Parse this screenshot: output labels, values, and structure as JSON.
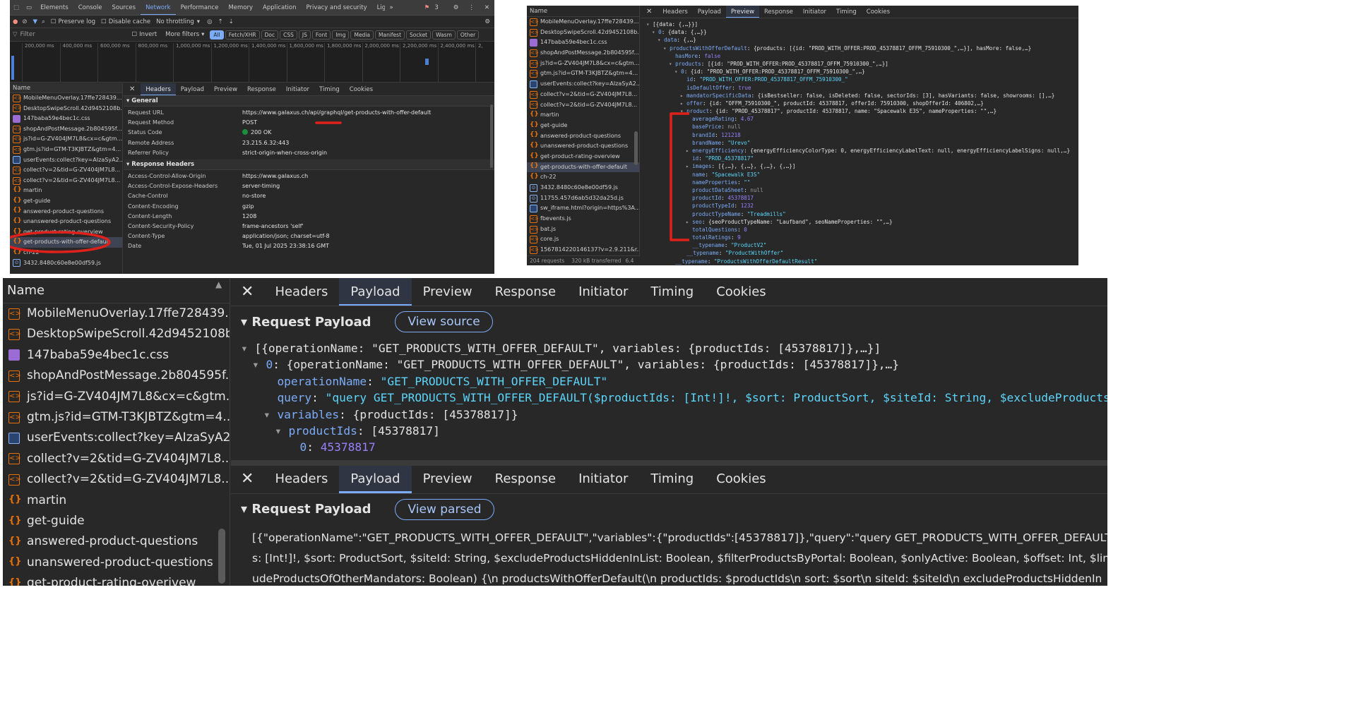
{
  "p1": {
    "toolbar_tabs": [
      "Elements",
      "Console",
      "Sources",
      "Network",
      "Performance",
      "Memory",
      "Application",
      "Privacy and security",
      "Lighthouse"
    ],
    "active_tab": "Network",
    "badge": "3",
    "preserve_log": "Preserve log",
    "disable_cache": "Disable cache",
    "throttling": "No throttling",
    "filter_placeholder": "Filter",
    "invert": "Invert",
    "more_filters": "More filters",
    "chips": [
      "All",
      "Fetch/XHR",
      "Doc",
      "CSS",
      "JS",
      "Font",
      "Img",
      "Media",
      "Manifest",
      "Socket",
      "Wasm",
      "Other"
    ],
    "ticks": [
      "200,000 ms",
      "400,000 ms",
      "600,000 ms",
      "800,000 ms",
      "1,000,000 ms",
      "1,200,000 ms",
      "1,400,000 ms",
      "1,600,000 ms",
      "1,800,000 ms",
      "2,000,000 ms",
      "2,200,000 ms",
      "2,400,000 ms",
      "2,"
    ],
    "list_header": "Name",
    "requests": [
      {
        "name": "MobileMenuOverlay.17ffe728439...",
        "type": "js"
      },
      {
        "name": "DesktopSwipeScroll.42d9452108b...",
        "type": "js"
      },
      {
        "name": "147baba59e4bec1c.css",
        "type": "css"
      },
      {
        "name": "shopAndPostMessage.2b804595f...",
        "type": "js"
      },
      {
        "name": "js?id=G-ZV404JM7L8&cx=c&gtm...",
        "type": "js"
      },
      {
        "name": "gtm.js?id=GTM-T3KJBTZ&gtm=4...",
        "type": "js"
      },
      {
        "name": "userEvents:collect?key=AIzaSyA2...",
        "type": "img"
      },
      {
        "name": "collect?v=2&tid=G-ZV404JM7L8...",
        "type": "js"
      },
      {
        "name": "collect?v=2&tid=G-ZV404JM7L8...",
        "type": "js"
      },
      {
        "name": "martin",
        "type": "gql"
      },
      {
        "name": "get-guide",
        "type": "gql"
      },
      {
        "name": "answered-product-questions",
        "type": "gql"
      },
      {
        "name": "unanswered-product-questions",
        "type": "gql"
      },
      {
        "name": "get-product-rating-overview",
        "type": "gql"
      },
      {
        "name": "get-products-with-offer-default",
        "type": "gql"
      },
      {
        "name": "ch-22",
        "type": "gql"
      },
      {
        "name": "3432.8480c60e8e00df59.js",
        "type": "doc"
      }
    ],
    "detail_tabs": [
      "Headers",
      "Payload",
      "Preview",
      "Response",
      "Initiator",
      "Timing",
      "Cookies"
    ],
    "detail_active": "Headers",
    "general_title": "General",
    "general": [
      {
        "k": "Request URL",
        "v": "https://www.galaxus.ch/api/graphql/get-products-with-offer-default"
      },
      {
        "k": "Request Method",
        "v": "POST"
      },
      {
        "k": "Status Code",
        "v": "200 OK"
      },
      {
        "k": "Remote Address",
        "v": "23.215.6.32:443"
      },
      {
        "k": "Referrer Policy",
        "v": "strict-origin-when-cross-origin"
      }
    ],
    "response_title": "Response Headers",
    "response": [
      {
        "k": "Access-Control-Allow-Origin",
        "v": "https://www.galaxus.ch"
      },
      {
        "k": "Access-Control-Expose-Headers",
        "v": "server-timing"
      },
      {
        "k": "Cache-Control",
        "v": "no-store"
      },
      {
        "k": "Content-Encoding",
        "v": "gzip"
      },
      {
        "k": "Content-Length",
        "v": "1208"
      },
      {
        "k": "Content-Security-Policy",
        "v": "frame-ancestors 'self'"
      },
      {
        "k": "Content-Type",
        "v": "application/json; charset=utf-8"
      },
      {
        "k": "Date",
        "v": "Tue, 01 Jul 2025 23:38:16 GMT"
      }
    ],
    "colors": {
      "status_ok": "#1e8e3e",
      "annotation": "#e0201b"
    }
  },
  "p2": {
    "list_header": "Name",
    "requests": [
      {
        "name": "MobileMenuOverlay.17ffe728439...",
        "type": "js"
      },
      {
        "name": "DesktopSwipeScroll.42d9452108b...",
        "type": "js"
      },
      {
        "name": "147baba59e4bec1c.css",
        "type": "css"
      },
      {
        "name": "shopAndPostMessage.2b804595f...",
        "type": "js"
      },
      {
        "name": "js?id=G-ZV404JM7L8&cx=c&gtm...",
        "type": "js"
      },
      {
        "name": "gtm.js?id=GTM-T3KJBTZ&gtm=4...",
        "type": "js"
      },
      {
        "name": "userEvents:collect?key=AIzaSyA2...",
        "type": "img"
      },
      {
        "name": "collect?v=2&tid=G-ZV404JM7L8...",
        "type": "js"
      },
      {
        "name": "collect?v=2&tid=G-ZV404JM7L8...",
        "type": "js"
      },
      {
        "name": "martin",
        "type": "gql"
      },
      {
        "name": "get-guide",
        "type": "gql"
      },
      {
        "name": "answered-product-questions",
        "type": "gql"
      },
      {
        "name": "unanswered-product-questions",
        "type": "gql"
      },
      {
        "name": "get-product-rating-overview",
        "type": "gql"
      },
      {
        "name": "get-products-with-offer-default",
        "type": "gql"
      },
      {
        "name": "ch-22",
        "type": "gql"
      },
      {
        "name": "3432.8480c60e8e00df59.js",
        "type": "doc"
      },
      {
        "name": "11755.457d6ab5d32da25d.js",
        "type": "doc"
      },
      {
        "name": "sw_iframe.html?origin=https%3A...",
        "type": "img"
      },
      {
        "name": "fbevents.js",
        "type": "js"
      },
      {
        "name": "bat.js",
        "type": "js"
      },
      {
        "name": "core.js",
        "type": "js"
      },
      {
        "name": "1567814220146137?v=2.9.211&r...",
        "type": "js"
      }
    ],
    "status": "204 requests",
    "transferred": "320 kB transferred",
    "transferred_tail": "6.4",
    "detail_tabs": [
      "Headers",
      "Payload",
      "Preview",
      "Response",
      "Initiator",
      "Timing",
      "Cookies"
    ],
    "detail_active": "Preview",
    "tree": [
      {
        "i": 0,
        "a": "▾",
        "t": [
          [
            "k2",
            "[{data: {,…}}]"
          ]
        ]
      },
      {
        "i": 1,
        "a": "▾",
        "t": [
          [
            "k1",
            "0"
          ],
          [
            "k2",
            ": {data: {,…}}"
          ]
        ]
      },
      {
        "i": 2,
        "a": "▾",
        "t": [
          [
            "k1",
            "data"
          ],
          [
            "k2",
            ": {,…}"
          ]
        ]
      },
      {
        "i": 3,
        "a": "▾",
        "t": [
          [
            "k1",
            "productsWithOfferDefault"
          ],
          [
            "k2",
            ": {products: [{id: \"PROD_WITH_OFFER:PROD_45378817_OFFM_75910300_\",…}], hasMore: false,…}"
          ]
        ]
      },
      {
        "i": 4,
        "a": "",
        "t": [
          [
            "k1",
            "hasMore"
          ],
          [
            "k2",
            ": "
          ],
          [
            "b",
            "false"
          ]
        ]
      },
      {
        "i": 4,
        "a": "▾",
        "t": [
          [
            "k1",
            "products"
          ],
          [
            "k2",
            ": [{id: \"PROD_WITH_OFFER:PROD_45378817_OFFM_75910300_\",…}]"
          ]
        ]
      },
      {
        "i": 5,
        "a": "▾",
        "t": [
          [
            "k1",
            "0"
          ],
          [
            "k2",
            ": {id: \"PROD_WITH_OFFER:PROD_45378817_OFFM_75910300_\",…}"
          ]
        ]
      },
      {
        "i": 6,
        "a": "",
        "t": [
          [
            "k1",
            "id"
          ],
          [
            "k2",
            ": "
          ],
          [
            "str",
            "\"PROD_WITH_OFFER:PROD_45378817_OFFM_75910300_\""
          ]
        ]
      },
      {
        "i": 6,
        "a": "",
        "t": [
          [
            "k1",
            "isDefaultOffer"
          ],
          [
            "k2",
            ": "
          ],
          [
            "b",
            "true"
          ]
        ]
      },
      {
        "i": 6,
        "a": "▸",
        "t": [
          [
            "k1",
            "mandatorSpecificData"
          ],
          [
            "k2",
            ": {isBestseller: false, isDeleted: false, sectorIds: [3], hasVariants: false, showrooms: [],…}"
          ]
        ]
      },
      {
        "i": 6,
        "a": "▸",
        "t": [
          [
            "k1",
            "offer"
          ],
          [
            "k2",
            ": {id: \"OFFM_75910300_\", productId: 45378817, offerId: 75910300, shopOfferId: 406802,…}"
          ]
        ]
      },
      {
        "i": 6,
        "a": "▾",
        "t": [
          [
            "k1",
            "product"
          ],
          [
            "k2",
            ": {id: \"PROD_45378817\", productId: 45378817, name: \"Spacewalk E3S\", nameProperties: \"\",…}"
          ]
        ]
      },
      {
        "i": 7,
        "a": "",
        "t": [
          [
            "k1",
            "averageRating"
          ],
          [
            "k2",
            ": "
          ],
          [
            "n",
            "4.67"
          ]
        ]
      },
      {
        "i": 7,
        "a": "",
        "t": [
          [
            "k1",
            "basePrice"
          ],
          [
            "k2",
            ": "
          ],
          [
            "nl",
            "null"
          ]
        ]
      },
      {
        "i": 7,
        "a": "",
        "t": [
          [
            "k1",
            "brandId"
          ],
          [
            "k2",
            ": "
          ],
          [
            "n",
            "121218"
          ]
        ]
      },
      {
        "i": 7,
        "a": "",
        "t": [
          [
            "k1",
            "brandName"
          ],
          [
            "k2",
            ": "
          ],
          [
            "str",
            "\"Urevo\""
          ]
        ]
      },
      {
        "i": 7,
        "a": "▸",
        "t": [
          [
            "k1",
            "energyEfficiency"
          ],
          [
            "k2",
            ": {energyEfficiencyColorType: 0, energyEfficiencyLabelText: null, energyEfficiencyLabelSigns: null,…}"
          ]
        ]
      },
      {
        "i": 7,
        "a": "",
        "t": [
          [
            "k1",
            "id"
          ],
          [
            "k2",
            ": "
          ],
          [
            "str",
            "\"PROD_45378817\""
          ]
        ]
      },
      {
        "i": 7,
        "a": "▸",
        "t": [
          [
            "k1",
            "images"
          ],
          [
            "k2",
            ": [{,…}, {,…}, {,…}, {,…}]"
          ]
        ]
      },
      {
        "i": 7,
        "a": "",
        "t": [
          [
            "k1",
            "name"
          ],
          [
            "k2",
            ": "
          ],
          [
            "str",
            "\"Spacewalk E3S\""
          ]
        ]
      },
      {
        "i": 7,
        "a": "",
        "t": [
          [
            "k1",
            "nameProperties"
          ],
          [
            "k2",
            ": "
          ],
          [
            "str",
            "\"\""
          ]
        ]
      },
      {
        "i": 7,
        "a": "",
        "t": [
          [
            "k1",
            "productDataSheet"
          ],
          [
            "k2",
            ": "
          ],
          [
            "nl",
            "null"
          ]
        ]
      },
      {
        "i": 7,
        "a": "",
        "t": [
          [
            "k1",
            "productId"
          ],
          [
            "k2",
            ": "
          ],
          [
            "n",
            "45378817"
          ]
        ]
      },
      {
        "i": 7,
        "a": "",
        "t": [
          [
            "k1",
            "productTypeId"
          ],
          [
            "k2",
            ": "
          ],
          [
            "n",
            "1232"
          ]
        ]
      },
      {
        "i": 7,
        "a": "",
        "t": [
          [
            "k1",
            "productTypeName"
          ],
          [
            "k2",
            ": "
          ],
          [
            "str",
            "\"Treadmills\""
          ]
        ]
      },
      {
        "i": 7,
        "a": "▸",
        "t": [
          [
            "k1",
            "seo"
          ],
          [
            "k2",
            ": {seoProductTypeName: \"Laufband\", seoNameProperties: \"\",…}"
          ]
        ]
      },
      {
        "i": 7,
        "a": "",
        "t": [
          [
            "k1",
            "totalQuestions"
          ],
          [
            "k2",
            ": "
          ],
          [
            "n",
            "0"
          ]
        ]
      },
      {
        "i": 7,
        "a": "",
        "t": [
          [
            "k1",
            "totalRatings"
          ],
          [
            "k2",
            ": "
          ],
          [
            "n",
            "9"
          ]
        ]
      },
      {
        "i": 7,
        "a": "",
        "t": [
          [
            "k1",
            "__typename"
          ],
          [
            "k2",
            ": "
          ],
          [
            "str",
            "\"ProductV2\""
          ]
        ]
      },
      {
        "i": 6,
        "a": "",
        "t": [
          [
            "k1",
            "__typename"
          ],
          [
            "k2",
            ": "
          ],
          [
            "str",
            "\"ProductWithOffer\""
          ]
        ]
      },
      {
        "i": 4,
        "a": "",
        "t": [
          [
            "k1",
            "__typename"
          ],
          [
            "k2",
            ": "
          ],
          [
            "str",
            "\"ProductsWithOfferDefaultResult\""
          ]
        ]
      }
    ]
  },
  "p3": {
    "list_header": "Name",
    "requests": [
      {
        "name": "MobileMenuOverlay.17ffe728439...",
        "type": "js"
      },
      {
        "name": "DesktopSwipeScroll.42d9452108b...",
        "type": "js"
      },
      {
        "name": "147baba59e4bec1c.css",
        "type": "css"
      },
      {
        "name": "shopAndPostMessage.2b804595f...",
        "type": "js"
      },
      {
        "name": "js?id=G-ZV404JM7L8&cx=c&gtm...",
        "type": "js"
      },
      {
        "name": "gtm.js?id=GTM-T3KJBTZ&gtm=4...",
        "type": "js"
      },
      {
        "name": "userEvents:collect?key=AIzaSyA2...",
        "type": "img"
      },
      {
        "name": "collect?v=2&tid=G-ZV404JM7L8...",
        "type": "js"
      },
      {
        "name": "collect?v=2&tid=G-ZV404JM7L8...",
        "type": "js"
      },
      {
        "name": "martin",
        "type": "gql"
      },
      {
        "name": "get-guide",
        "type": "gql"
      },
      {
        "name": "answered-product-questions",
        "type": "gql"
      },
      {
        "name": "unanswered-product-questions",
        "type": "gql"
      },
      {
        "name": "get-product-rating-overivew",
        "type": "gql"
      }
    ],
    "detail_tabs": [
      "Headers",
      "Payload",
      "Preview",
      "Response",
      "Initiator",
      "Timing",
      "Cookies"
    ],
    "detail_active": "Payload",
    "upper": {
      "title": "Request Payload",
      "button": "View source",
      "lines": [
        {
          "i": 0,
          "a": "▾",
          "t": [
            [
              "k2",
              "[{operationName: \"GET_PRODUCTS_WITH_OFFER_DEFAULT\", variables: {productIds: [45378817]},…}]"
            ]
          ]
        },
        {
          "i": 1,
          "a": "▾",
          "t": [
            [
              "k1",
              "0"
            ],
            [
              "k2",
              ": {operationName: \"GET_PRODUCTS_WITH_OFFER_DEFAULT\", variables: {productIds: [45378817]},…}"
            ]
          ]
        },
        {
          "i": 2,
          "a": "",
          "t": [
            [
              "k1",
              "operationName"
            ],
            [
              "k2",
              ": "
            ],
            [
              "str",
              "\"GET_PRODUCTS_WITH_OFFER_DEFAULT\""
            ]
          ]
        },
        {
          "i": 2,
          "a": "",
          "t": [
            [
              "k1",
              "query"
            ],
            [
              "k2",
              ": "
            ],
            [
              "str",
              "\"query GET_PRODUCTS_WITH_OFFER_DEFAULT($productIds: [Int!]!, $sort: ProductSort, $siteId: String, $excludeProductsHiddenI"
            ]
          ]
        },
        {
          "i": 2,
          "a": "▾",
          "t": [
            [
              "k1",
              "variables"
            ],
            [
              "k2",
              ": {productIds: [45378817]}"
            ]
          ]
        },
        {
          "i": 3,
          "a": "▾",
          "t": [
            [
              "k1",
              "productIds"
            ],
            [
              "k2",
              ": [45378817]"
            ]
          ]
        },
        {
          "i": 4,
          "a": "",
          "t": [
            [
              "k1",
              "0"
            ],
            [
              "k2",
              ": "
            ],
            [
              "n",
              "45378817"
            ]
          ]
        }
      ]
    },
    "lower": {
      "title": "Request Payload",
      "button": "View parsed",
      "raw": [
        "[{\"operationName\":\"GET_PRODUCTS_WITH_OFFER_DEFAULT\",\"variables\":{\"productIds\":[45378817]},\"query\":\"query GET_PRODUCTS_WITH_OFFER_DEFAULT($productI",
        "s: [Int!]!, $sort: ProductSort, $siteId: String, $excludeProductsHiddenInList: Boolean, $filterProductsByPortal: Boolean, $onlyActive: Boolean, $offset: Int, $limit: Int, $in",
        "udeProductsOfOtherMandators: Boolean) {\\n  productsWithOfferDefault(\\n    productIds: $productIds\\n    sort: $sort\\n    siteId: $siteId\\n    excludeProductsHiddenIn"
      ]
    }
  }
}
